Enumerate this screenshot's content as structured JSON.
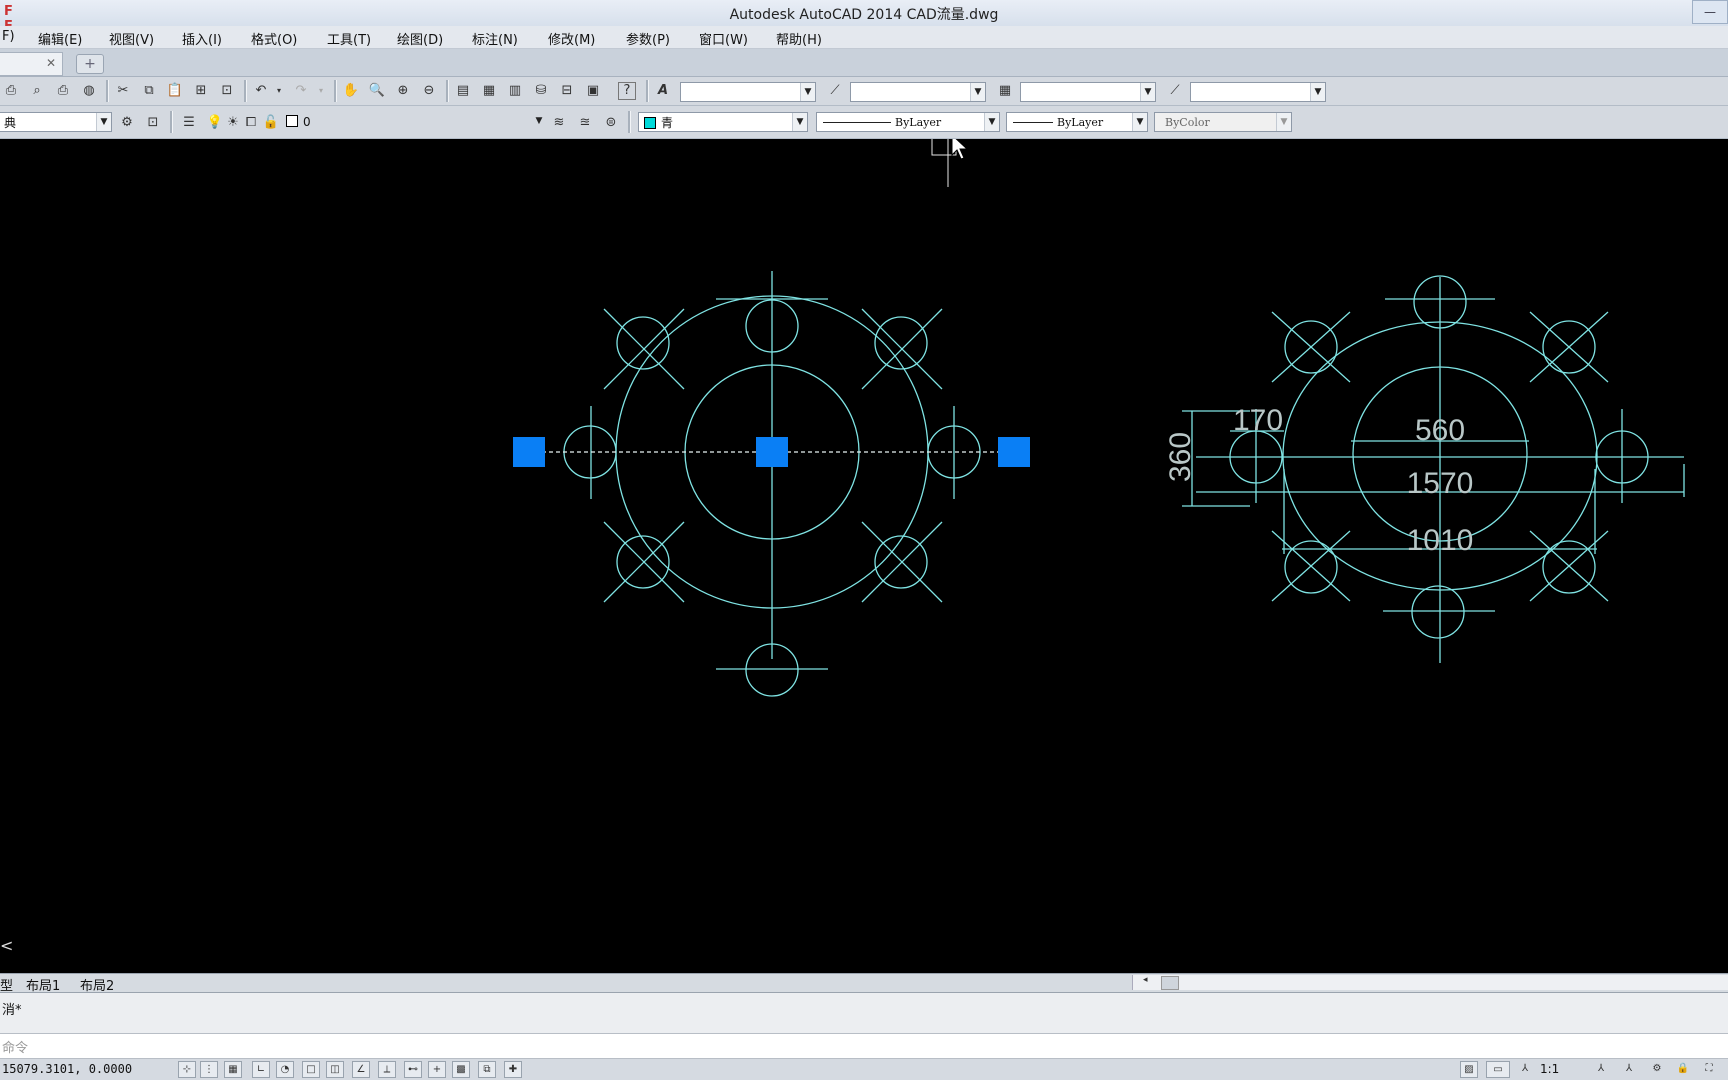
{
  "window": {
    "title": "Autodesk AutoCAD 2014    CAD流量.dwg"
  },
  "menu": [
    "F)",
    "编辑(E)",
    "视图(V)",
    "插入(I)",
    "格式(O)",
    "工具(T)",
    "绘图(D)",
    "标注(N)",
    "修改(M)",
    "参数(P)",
    "窗口(W)",
    "帮助(H)"
  ],
  "toolbar2": {
    "workspace": "典",
    "layer_name": "0",
    "color": "青",
    "linetype": "ByLayer",
    "lineweight": "ByLayer",
    "plotstyle": "ByColor"
  },
  "drawing": {
    "dimensions": [
      "170",
      "360",
      "560",
      "1570",
      "1010"
    ],
    "linework_color": "#7fe3e3",
    "grip_color": "#0a7ff5"
  },
  "layout_tabs": [
    "型",
    "布局1",
    "布局2"
  ],
  "command_history": "消*",
  "command_prompt": "命令",
  "status": {
    "coordinates": "15079.3101,  0.0000",
    "annotation_scale": "1:1"
  }
}
